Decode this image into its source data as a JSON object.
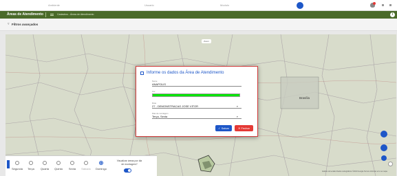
{
  "topbar": {
    "col1": "Ambiente",
    "col2": "Usuario",
    "col3": "Modulo"
  },
  "header": {
    "title": "Áreas de Atendimento",
    "breadcrumb": "Cadastros - Áreas de Atendimento",
    "info_icon": "info-icon"
  },
  "filters": {
    "label": "Filtros avançados",
    "icon": "filter-icon"
  },
  "map": {
    "city_label": "Brasília",
    "zoom_hint": "Zoom",
    "attribution": "Atalhos do teclado  Dados cartográficos ©2023 Google  Termos  Informar erro no mapa"
  },
  "days": {
    "items": [
      {
        "label": "Segunda",
        "selected": false,
        "enabled": true
      },
      {
        "label": "Terça",
        "selected": false,
        "enabled": true
      },
      {
        "label": "Quarta",
        "selected": false,
        "enabled": true
      },
      {
        "label": "Quinta",
        "selected": false,
        "enabled": true
      },
      {
        "label": "Sexta",
        "selected": false,
        "enabled": true
      },
      {
        "label": "Sábado",
        "selected": false,
        "enabled": false
      },
      {
        "label": "Domingo",
        "selected": true,
        "enabled": true
      }
    ],
    "visualize_label": "Visualizar áreas por dia de montagem?",
    "visualize_on": true
  },
  "dialog": {
    "title": "Informe os dados da Área de Atendimento",
    "name_label": "Nome",
    "name_value": "ANAPOLIS",
    "color_label": "Cor",
    "color_value": "#00e600",
    "route_label": "Rota",
    "route_value": "27 - DEMONSTRACAO JOSE VITOR",
    "days_label": "Dias de montagem",
    "days_value": "Terça, Sexta",
    "save_label": "Salvar",
    "close_label": "Fechar",
    "accent": "#1e57c8",
    "danger": "#e53935"
  }
}
